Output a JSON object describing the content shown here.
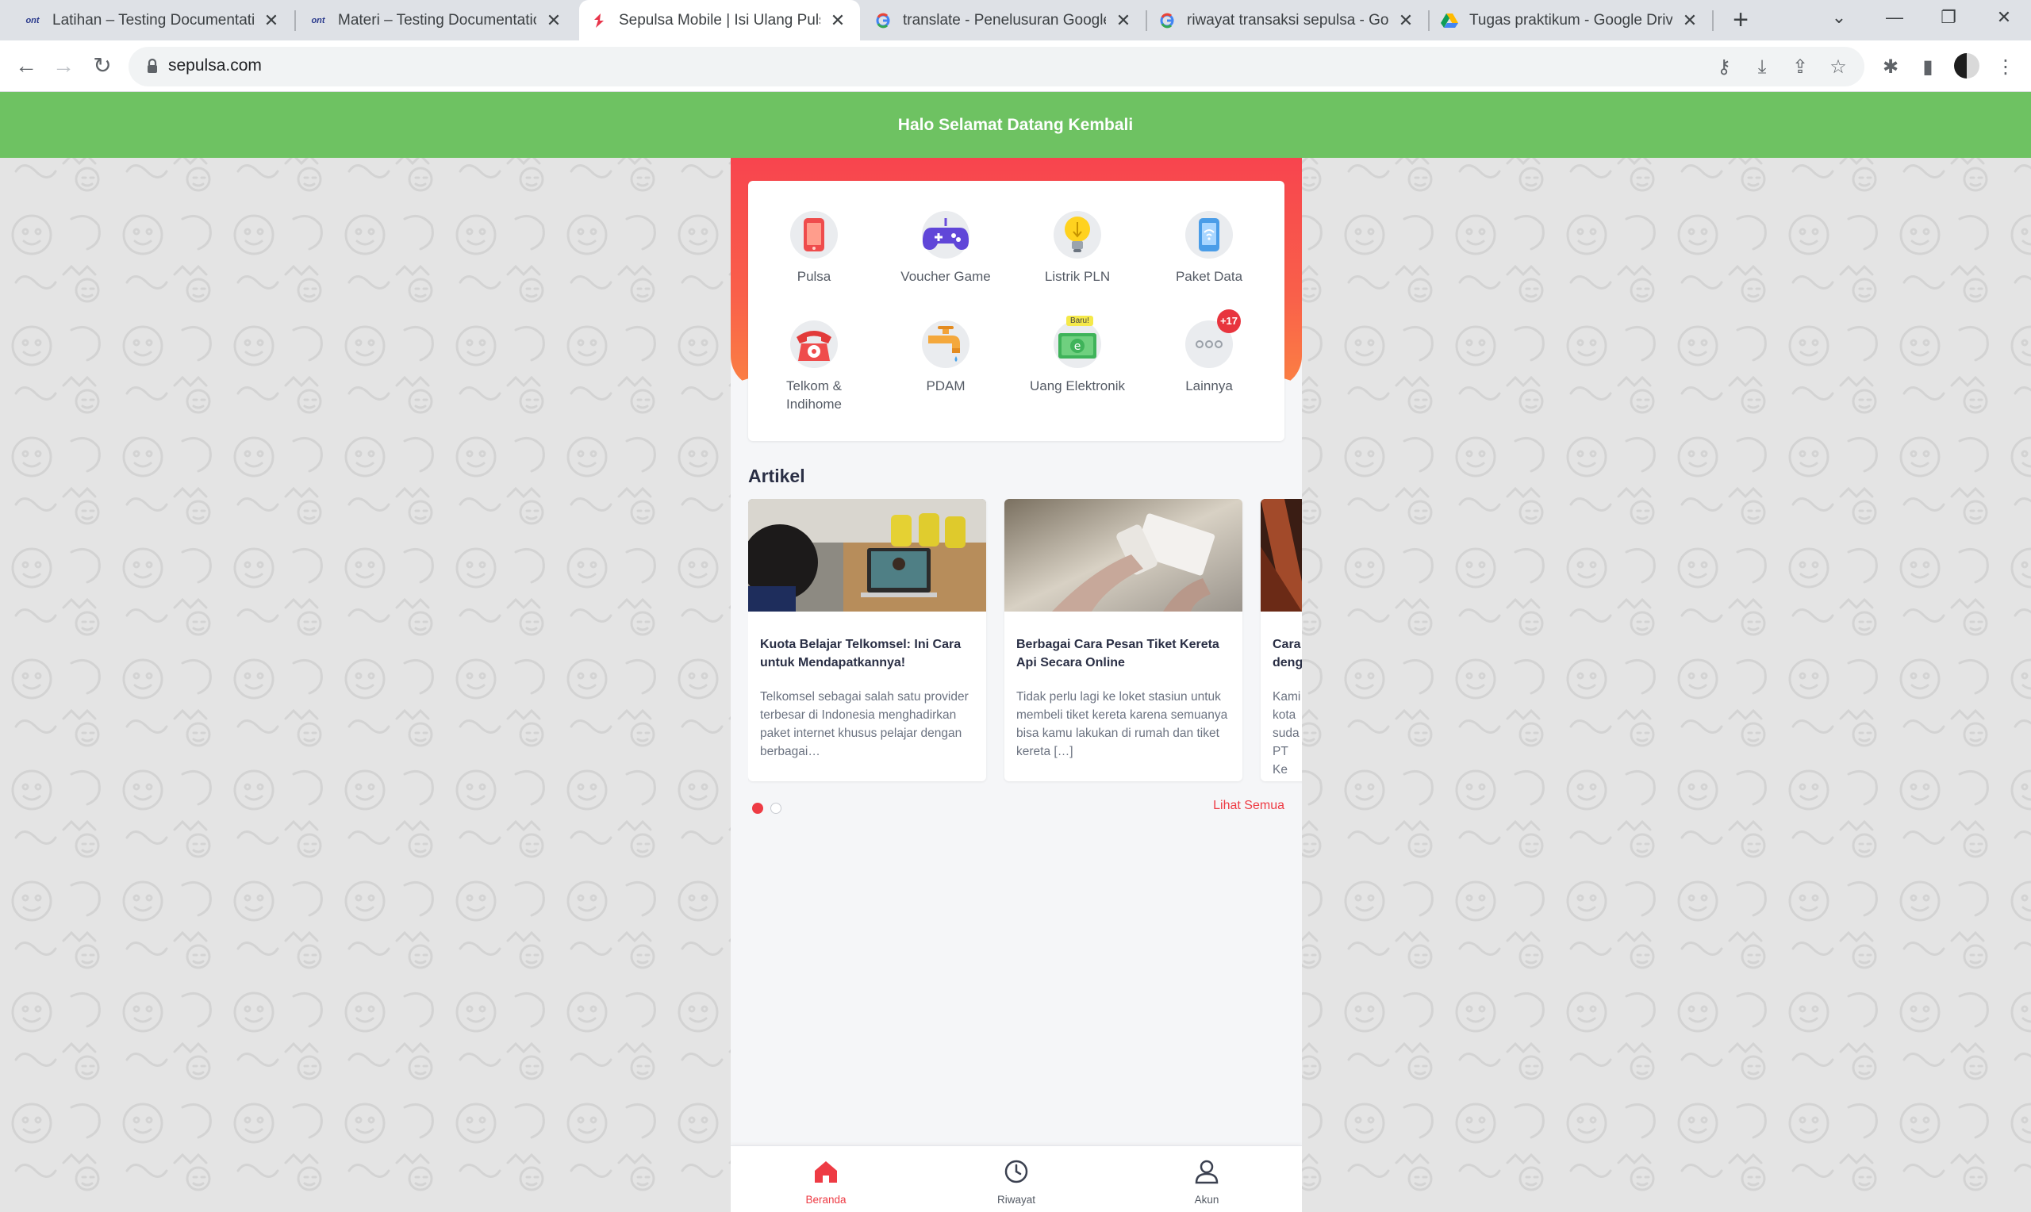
{
  "browser": {
    "tabs": [
      {
        "title": "Latihan – Testing Documentation",
        "favicon": "ont-logo-icon"
      },
      {
        "title": "Materi – Testing Documentation",
        "favicon": "ont-logo-icon"
      },
      {
        "title": "Sepulsa Mobile | Isi Ulang Pulsa S",
        "favicon": "sepulsa-logo-icon",
        "active": true
      },
      {
        "title": "translate - Penelusuran Google",
        "favicon": "google-g-icon"
      },
      {
        "title": "riwayat transaksi sepulsa - Googl",
        "favicon": "google-g-icon"
      },
      {
        "title": "Tugas praktikum - Google Drive",
        "favicon": "google-drive-icon"
      }
    ],
    "url": "sepulsa.com",
    "brand_ont": "ont",
    "colors": {
      "tabstrip": "#dee1e6",
      "toolbar": "#ffffff",
      "omnibox": "#f1f3f4"
    }
  },
  "page": {
    "banner": "Halo Selamat Datang Kembali",
    "menu": [
      {
        "label": "Pulsa",
        "icon": "phone-icon"
      },
      {
        "label": "Voucher Game",
        "icon": "gamepad-icon"
      },
      {
        "label": "Listrik PLN",
        "icon": "lightbulb-icon"
      },
      {
        "label": "Paket Data",
        "icon": "phone-wifi-icon"
      },
      {
        "label": "Telkom & Indihome",
        "icon": "telephone-icon"
      },
      {
        "label": "PDAM",
        "icon": "water-tap-icon"
      },
      {
        "label": "Uang Elektronik",
        "icon": "e-money-icon",
        "tag": "Baru!"
      },
      {
        "label": "Lainnya",
        "icon": "more-dots-icon",
        "badge": "+17"
      }
    ],
    "articles_title": "Artikel",
    "articles": [
      {
        "title": "Kuota Belajar Telkomsel: Ini Cara untuk Mendapatkannya!",
        "desc": "Telkomsel sebagai salah satu provider terbesar di Indonesia menghadirkan paket internet khusus pelajar dengan berbagai…"
      },
      {
        "title": "Berbagai Cara Pesan Tiket Kereta Api Secara Online",
        "desc": "Tidak perlu lagi ke loket stasiun untuk membeli tiket kereta karena semuanya bisa kamu lakukan di rumah dan tiket kereta […]"
      },
      {
        "title": "Cara deng",
        "desc": "Kami kota suda PT Ke"
      }
    ],
    "see_all": "Lihat Semua",
    "bottom_nav": [
      {
        "label": "Beranda",
        "icon": "home-icon",
        "active": true
      },
      {
        "label": "Riwayat",
        "icon": "clock-icon"
      },
      {
        "label": "Akun",
        "icon": "user-icon"
      }
    ],
    "colors": {
      "banner": "#6ec262",
      "accent": "#ee3b44",
      "hero_top": "#f8444e",
      "hero_bottom": "#fb8143"
    }
  }
}
